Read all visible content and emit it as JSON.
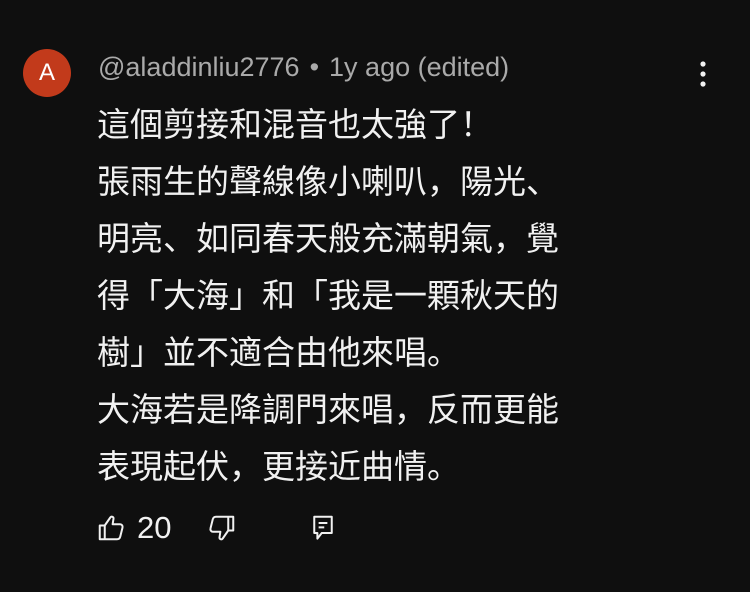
{
  "comment": {
    "avatar_letter": "A",
    "avatar_color": "#c23a1b",
    "author": "@aladdinliu2776",
    "separator": "•",
    "time": "1y ago (edited)",
    "lines": [
      "這個剪接和混音也太強了！",
      "張雨生的聲線像小喇叭，陽光、",
      "明亮、如同春天般充滿朝氣，覺",
      "得「大海」和「我是一顆秋天的",
      "樹」並不適合由他來唱。",
      "大海若是降調門來唱，反而更能",
      "表現起伏，更接近曲情。"
    ],
    "like_count": "20"
  },
  "icons": {
    "more": "vertical-dots-icon",
    "like": "thumbs-up-icon",
    "dislike": "thumbs-down-icon",
    "reply": "reply-comment-icon"
  },
  "colors": {
    "background": "#0f0f0f",
    "text": "#f1f1f1",
    "meta_text": "#aaaaaa"
  }
}
